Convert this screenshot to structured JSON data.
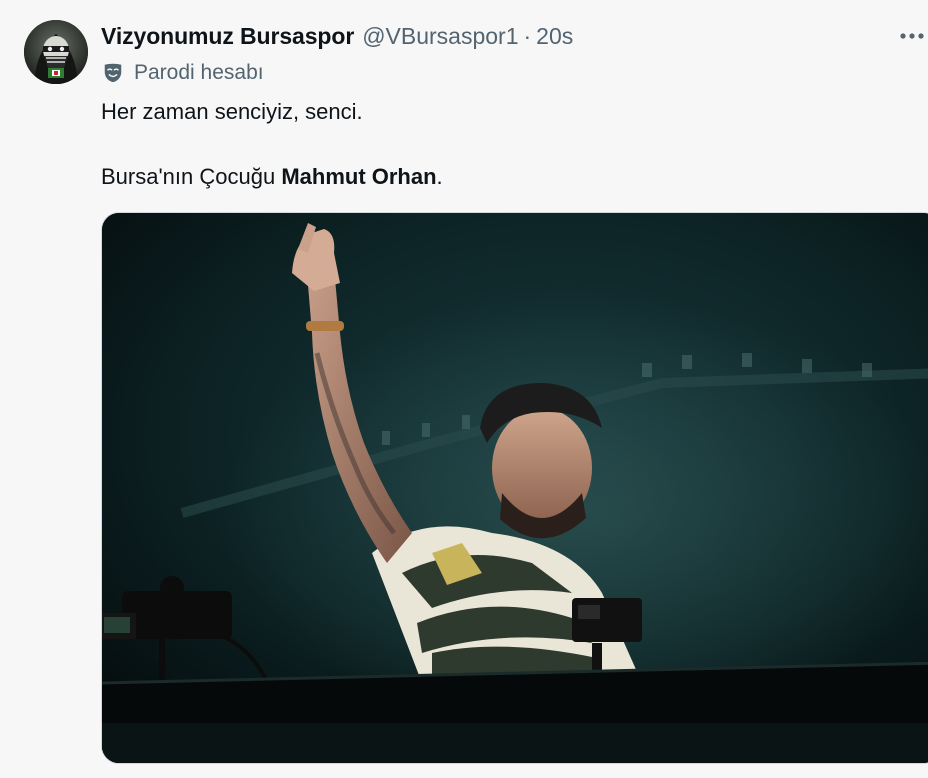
{
  "tweet": {
    "author_name": "Vizyonumuz Bursaspor",
    "handle": "@VBursaspor1",
    "separator": "·",
    "time": "20s",
    "parody_label": "Parodi hesabı",
    "line1": "Her zaman senciyiz, senci.",
    "line2_prefix": "Bursa'nın Çocuğu ",
    "line2_bold": "Mahmut Orhan",
    "line2_suffix": "."
  },
  "icons": {
    "more": "more-horizontal-icon",
    "parody": "parody-mask-icon"
  },
  "colors": {
    "text_primary": "#0f1419",
    "text_secondary": "#536471",
    "background": "#f7f7f7"
  }
}
